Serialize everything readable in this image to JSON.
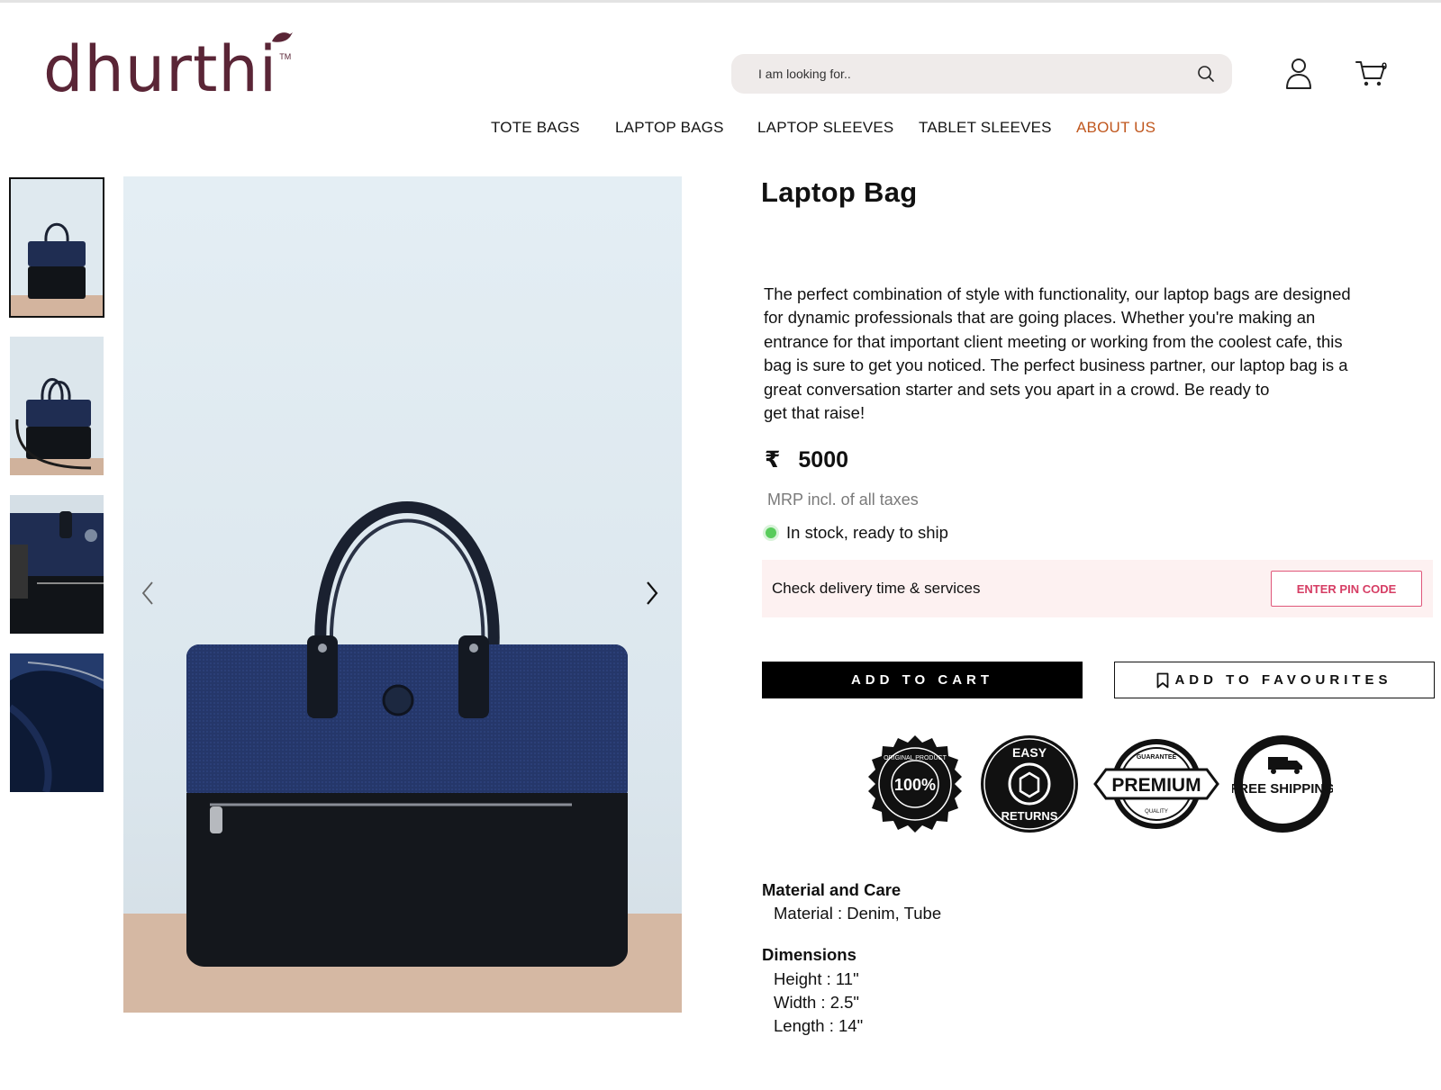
{
  "header": {
    "logo": "dhurthi",
    "logo_tm": "TM",
    "search": {
      "placeholder": "I am looking for.."
    },
    "cart_count": "0"
  },
  "nav": {
    "items": [
      {
        "label": "TOTE BAGS"
      },
      {
        "label": "LAPTOP BAGS"
      },
      {
        "label": "LAPTOP SLEEVES"
      },
      {
        "label": "TABLET SLEEVES"
      },
      {
        "label": "ABOUT US"
      }
    ],
    "active_index": 4,
    "active_color": "#c0571e"
  },
  "gallery": {
    "thumbnail_count": 4,
    "selected_index": 0
  },
  "product": {
    "title": "Laptop Bag",
    "description_lines": [
      "The perfect combination of style with functionality, our laptop bags are designed",
      "for dynamic professionals that are going places. Whether you're making an",
      "entrance for that important client meeting or working from the coolest cafe, this",
      "bag is sure to get you noticed. The perfect business partner, our laptop bag is a",
      "great conversation starter and sets you apart in a crowd. Be ready to",
      "get that raise!"
    ],
    "currency_symbol": "₹",
    "price": "5000",
    "mrp_note": "MRP incl. of all taxes",
    "stock_status": "In stock, ready to ship",
    "stock_color": "#59cc5c"
  },
  "delivery": {
    "label": "Check delivery time & services",
    "pin_button": "ENTER PIN CODE"
  },
  "actions": {
    "add_to_cart": "ADD TO CART",
    "add_to_favourites": "ADD TO FAVOURITES"
  },
  "badges": {
    "original": {
      "top": "ORIGINAL PRODUCT",
      "center": "100%"
    },
    "returns": {
      "top": "EASY",
      "bottom": "RETURNS"
    },
    "premium": {
      "top": "GUARANTEE",
      "center": "PREMIUM",
      "bottom": "QUALITY"
    },
    "shipping": {
      "center": "FREE SHIPPING"
    }
  },
  "material": {
    "heading": "Material and Care",
    "lines": [
      "Material : Denim, Tube"
    ]
  },
  "dimensions": {
    "heading": "Dimensions",
    "lines": [
      "Height : 11\"",
      "Width : 2.5\"",
      "Length : 14\""
    ]
  }
}
